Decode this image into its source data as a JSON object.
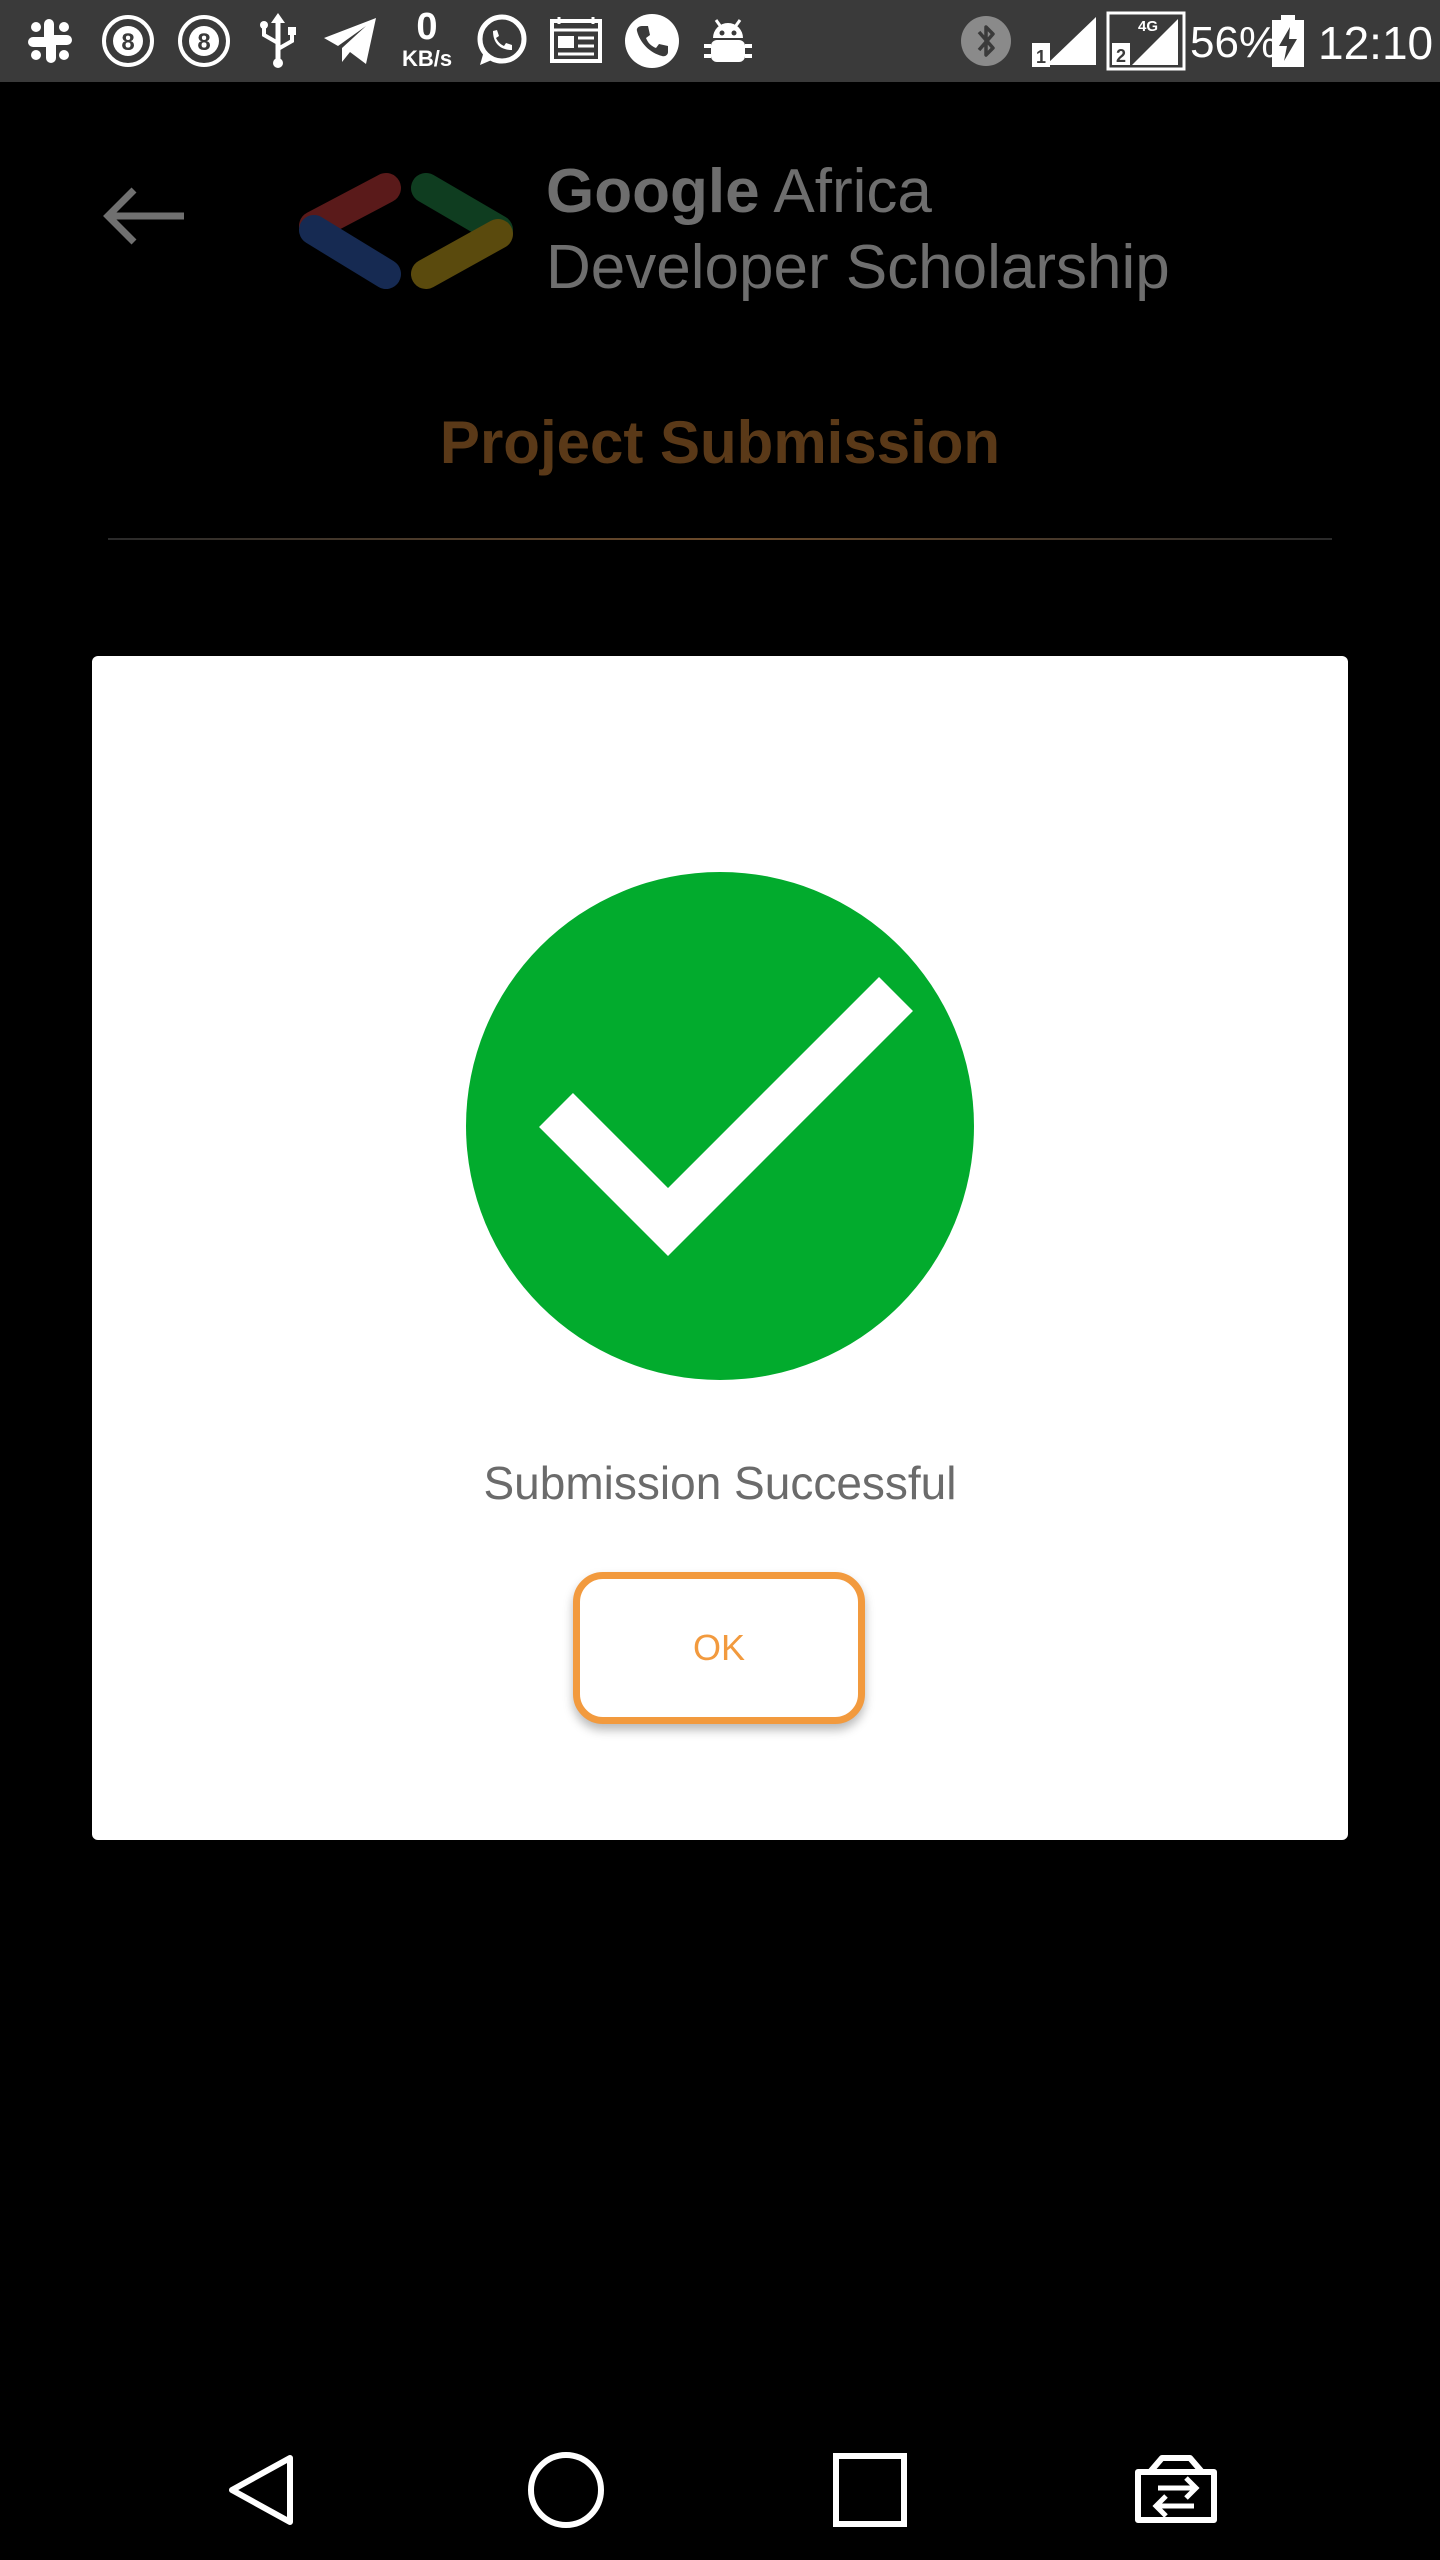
{
  "status_bar": {
    "icons": [
      "slack-icon",
      "eight-ball-icon",
      "eight-ball-icon",
      "usb-icon",
      "telegram-icon",
      "whatsapp-icon",
      "news-icon",
      "phone-icon",
      "android-debug-icon",
      "bluetooth-icon",
      "sim1-signal-icon",
      "sim2-4g-signal-icon",
      "battery-charging-icon"
    ],
    "net_speed_value": "0",
    "net_speed_unit": "KB/s",
    "sim1_label": "1",
    "sim2_label": "2",
    "network_type": "4G",
    "battery": "56%",
    "time": "12:10"
  },
  "header": {
    "back_icon": "arrow-left-icon",
    "brand_line1_bold": "Google",
    "brand_line1_rest": " Africa",
    "brand_line2": "Developer Scholarship",
    "logo_colors": [
      "#c42c2c",
      "#2a55b0",
      "#1f8a3c",
      "#c9a11a"
    ]
  },
  "page": {
    "title": "Project Submission"
  },
  "dialog": {
    "icon": "check-circle-icon",
    "icon_color": "#02ab2d",
    "message": "Submission Successful",
    "ok_label": "OK",
    "accent": "#f29a3e"
  },
  "nav_bar": {
    "items": [
      "back-triangle-icon",
      "home-circle-icon",
      "recents-square-icon",
      "switch-app-icon"
    ]
  }
}
